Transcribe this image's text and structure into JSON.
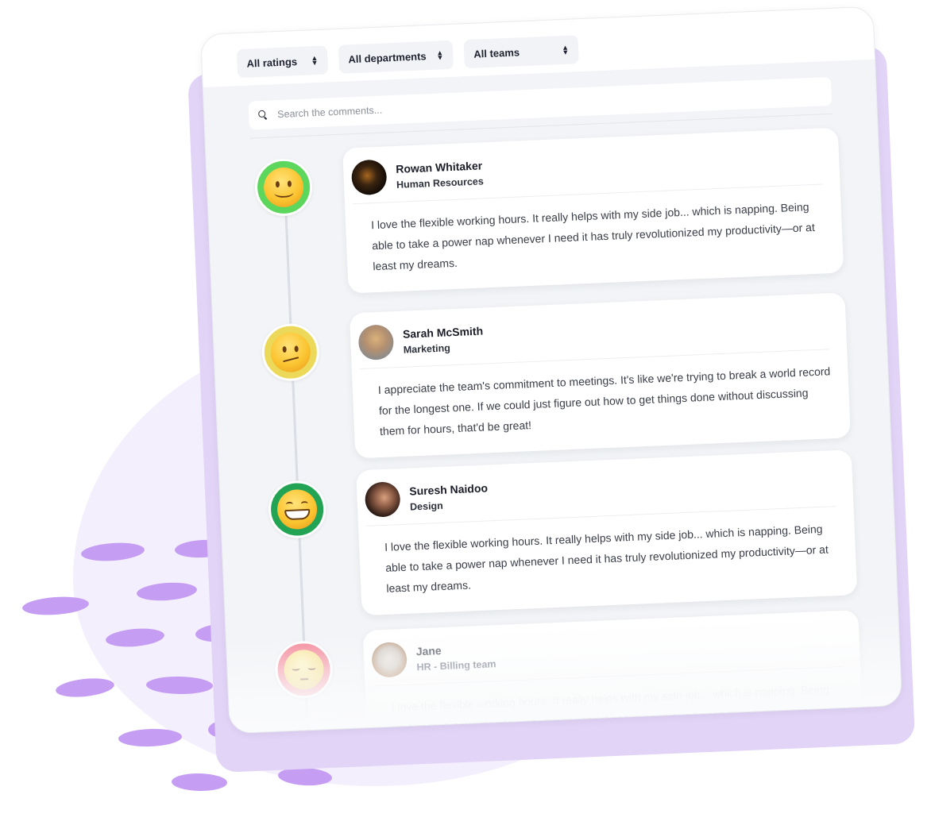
{
  "filters": [
    {
      "label": "All ratings",
      "icon": "sort-icon"
    },
    {
      "label": "All departments",
      "icon": "sort-icon"
    },
    {
      "label": "All teams",
      "icon": "sort-icon"
    }
  ],
  "search": {
    "placeholder": "Search the comments...",
    "value": "",
    "icon": "search-icon"
  },
  "comments": [
    {
      "rating": "happy",
      "rating_icon": "slightly-smiling-face-icon",
      "rating_color": "#5cd65c",
      "name": "Rowan Whitaker",
      "department": "Human Resources",
      "text": "I love the flexible working hours. It really helps with my side job... which is napping. Being able to take a power nap whenever I need it has truly revolutionized my productivity—or at least my dreams."
    },
    {
      "rating": "neutral",
      "rating_icon": "confused-face-icon",
      "rating_color": "#ecd95a",
      "name": "Sarah McSmith",
      "department": "Marketing",
      "text": "I appreciate the team's commitment to meetings. It's like we're trying to break a world record for the longest one. If we could just figure out how to get things done without discussing them for hours, that'd be great!"
    },
    {
      "rating": "very-happy",
      "rating_icon": "grinning-face-icon",
      "rating_color": "#23a455",
      "name": "Suresh Naidoo",
      "department": "Design",
      "text": "I love the flexible working hours. It really helps with my side job... which is napping. Being able to take a power nap whenever I need it has truly revolutionized my productivity—or at least my dreams."
    },
    {
      "rating": "sad",
      "rating_icon": "pensive-face-icon",
      "rating_color": "#f48b9b",
      "name": "Jane",
      "department": "HR - Billing team",
      "text": "I love the flexible working hours. It really helps with my side job... which is napping. Being able to take a power nap whenever I need it has truly revolutionized my"
    }
  ],
  "colors": {
    "accent_purple": "#c59ef3",
    "backplate": "#e2d4f7",
    "blob": "#f4effc",
    "panel_bg": "#f2f4f7"
  }
}
